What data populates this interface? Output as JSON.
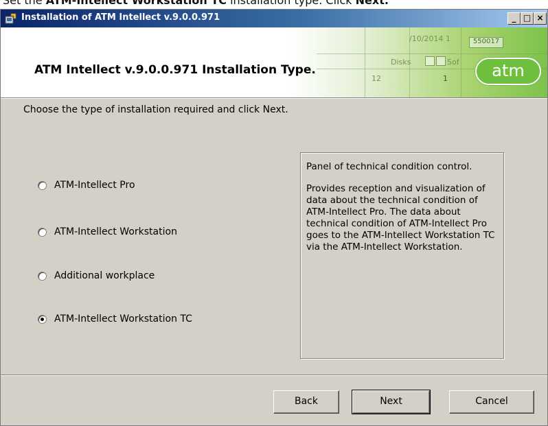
{
  "document_text": {
    "lead": "Set the ",
    "bold": "ATM-Intellect Workstation TC",
    "tail": " installation type. Click ",
    "next_bold": "Next."
  },
  "window": {
    "title": "Installation of ATM Intellect v.9.0.0.971",
    "minimize_glyph": "_",
    "maximize_glyph": "□",
    "close_glyph": "×"
  },
  "banner": {
    "title": "ATM Intellect v.9.0.0.971 Installation Type.",
    "logo_text": "atm",
    "art_texts": [
      "/10/2014 1",
      "550017",
      "Disks",
      "Sof",
      "12",
      "1"
    ]
  },
  "instruction": "Choose the type of installation required and click Next.",
  "options": [
    {
      "label": "ATM-Intellect Pro",
      "checked": false
    },
    {
      "label": "ATM-Intellect Workstation",
      "checked": false
    },
    {
      "label": "Additional workplace",
      "checked": false
    },
    {
      "label": "ATM-Intellect Workstation TC",
      "checked": true
    }
  ],
  "description": {
    "title": "Panel of technical condition control.",
    "body": "Provides reception and visualization of data about the technical condition of ATM-Intellect Pro. The data about technical condition of ATM-Intellect Pro goes to the ATM-Intellect Workstation TC via the ATM-Intellect Workstation."
  },
  "buttons": {
    "back": "Back",
    "next": "Next",
    "cancel": "Cancel"
  },
  "colors": {
    "titlebar": "#0a246a",
    "logo": "#6fbf3f",
    "dialog_face": "#d4d0c8"
  }
}
